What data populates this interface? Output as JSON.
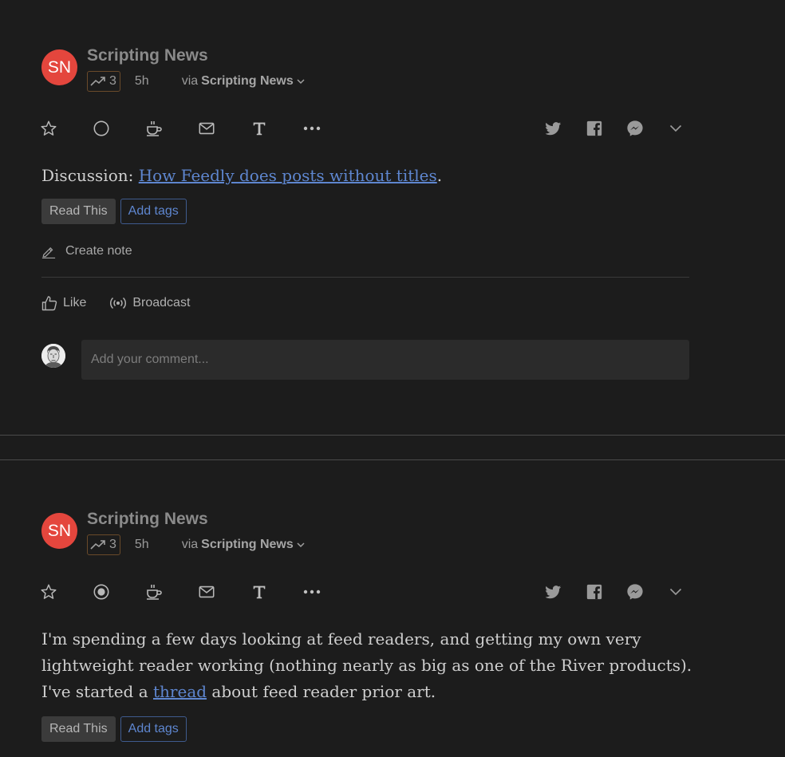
{
  "posts": [
    {
      "avatar_initials": "SN",
      "source": "Scripting News",
      "trend_count": "3",
      "age": "5h",
      "via_prefix": "via",
      "via_source": "Scripting News",
      "body_prefix": "Discussion: ",
      "body_link": "How Feedly does posts without titles",
      "body_suffix": ".",
      "read_this": "Read This",
      "add_tags": "Add tags",
      "create_note": "Create note",
      "like": "Like",
      "broadcast": "Broadcast",
      "comment_placeholder": "Add your comment..."
    },
    {
      "avatar_initials": "SN",
      "source": "Scripting News",
      "trend_count": "3",
      "age": "5h",
      "via_prefix": "via",
      "via_source": "Scripting News",
      "body_line1": "I'm spending a few days looking at feed readers, and getting my own very",
      "body_line2": "lightweight reader working (nothing nearly as big as one of the River products).",
      "body_line3_prefix": "I've started a ",
      "body_line3_link": "thread",
      "body_line3_suffix": " about feed reader prior art.",
      "read_this": "Read This",
      "add_tags": "Add tags"
    }
  ],
  "icons": {
    "toolbar_left": [
      "star-icon",
      "circle-icon",
      "coffee-cup-icon",
      "mail-icon",
      "text-format-icon",
      "more-dots-icon"
    ],
    "toolbar_right": [
      "twitter-icon",
      "facebook-icon",
      "messenger-icon",
      "chevron-down-icon"
    ]
  },
  "colors": {
    "background": "#1c1c1c",
    "avatar": "#e4463d",
    "link": "#5e86cf",
    "trend_border": "#6a4a2a"
  }
}
